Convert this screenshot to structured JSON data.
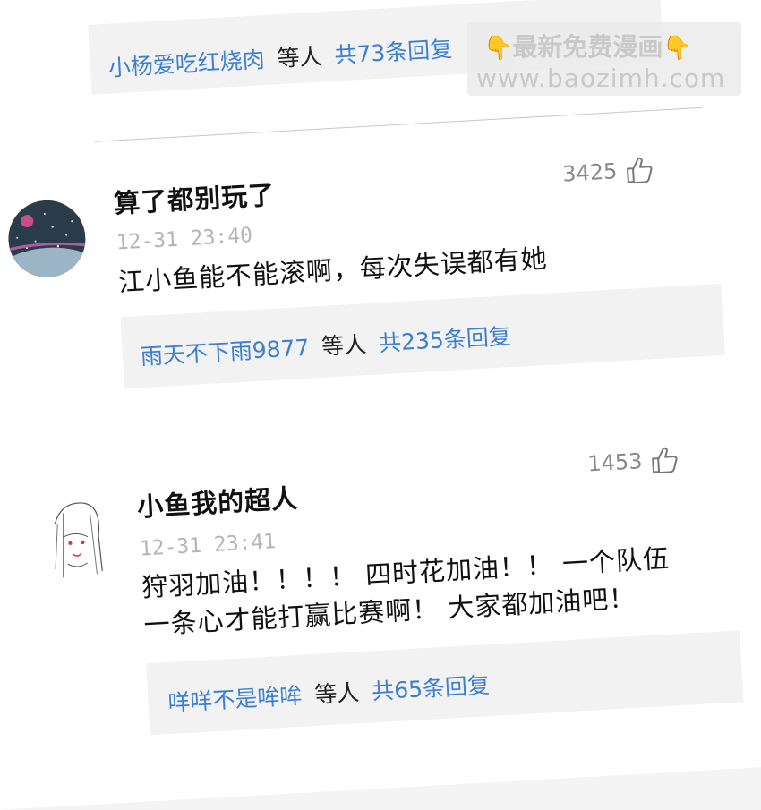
{
  "top_reply": {
    "user": "小杨爱吃红烧肉",
    "middle": "等人",
    "count": "共73条回复"
  },
  "comments": [
    {
      "username": "算了都别玩了",
      "time": "12-31  23:40",
      "likes": "3425",
      "lines": [
        "江小鱼能不能滚啊，每次失误都有她"
      ],
      "reply": {
        "user": "雨天不下雨9877",
        "middle": "等人",
        "count": "共235条回复"
      }
    },
    {
      "username": "小鱼我的超人",
      "time": "12-31  23:41",
      "likes": "1453",
      "lines": [
        "狩羽加油！！！！ 四时花加油！！ 一个队伍",
        "一条心才能打赢比赛啊！ 大家都加油吧！"
      ],
      "reply": {
        "user": "咩咩不是哞哞",
        "middle": "等人",
        "count": "共65条回复"
      }
    }
  ],
  "watermark": {
    "line1": "最新免费漫画",
    "line2": "www.baozimh.com"
  },
  "icons": {
    "like": "thumbs-up-icon",
    "pointer": "pointing-down-icon"
  },
  "colors": {
    "link": "#3d7fd1",
    "reply_bg": "#f2f2f2",
    "timestamp": "#b5b5b5"
  }
}
